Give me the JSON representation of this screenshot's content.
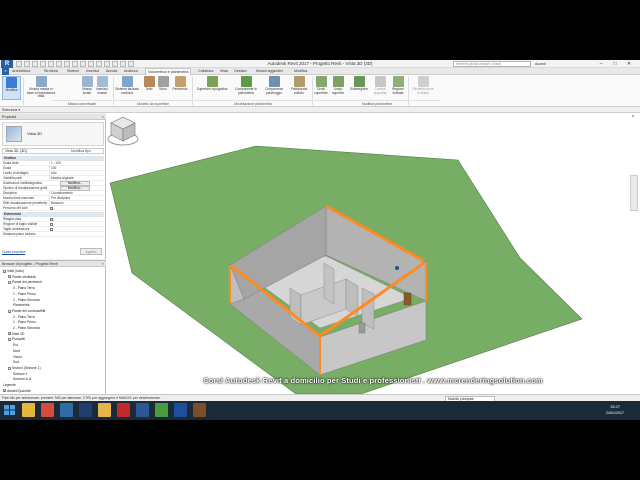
{
  "window": {
    "app_logo": "R",
    "title": "Autodesk Revit 2017 -   Progetto Revit - Vista 3D (3D)",
    "search_placeholder": "Immetti parola chiave o frase",
    "login": "Accedi",
    "min": "–",
    "max": "□",
    "close": "✕"
  },
  "ribbon": {
    "tabs": [
      {
        "label": "Architettura",
        "active": false
      },
      {
        "label": "Struttura",
        "active": false
      },
      {
        "label": "Sistemi",
        "active": false
      },
      {
        "label": "Inserisci",
        "active": false
      },
      {
        "label": "Annota",
        "active": false
      },
      {
        "label": "Analizza",
        "active": false
      },
      {
        "label": "Volumetrico e planimetria",
        "active": true
      },
      {
        "label": "Collabora",
        "active": false
      },
      {
        "label": "Vista",
        "active": false
      },
      {
        "label": "Gestisci",
        "active": false
      },
      {
        "label": "Moduli aggiuntivi",
        "active": false
      },
      {
        "label": "Modifica",
        "active": false
      }
    ],
    "buttons": [
      {
        "label": "Modifica",
        "icon": "cursor-icon",
        "color": "#3a7bd5"
      },
      {
        "label": "Mostra massa in base a impostazioni vista",
        "icon": "mass-icon",
        "color": "#8aa9c9"
      },
      {
        "label": "Massa locale",
        "icon": "local-mass-icon",
        "color": "#9bb4cf"
      },
      {
        "label": "Inserisci massa",
        "icon": "place-mass-icon",
        "color": "#a3bbd3"
      },
      {
        "label": "Sistema facciata continua",
        "icon": "curtain-system-icon",
        "color": "#7ea6cc"
      },
      {
        "label": "Tetto",
        "icon": "roof-icon",
        "color": "#b88a5a"
      },
      {
        "label": "Muro",
        "icon": "wall-icon",
        "color": "#a0a0a0"
      },
      {
        "label": "Pavimento",
        "icon": "floor-icon",
        "color": "#c2a16f"
      },
      {
        "label": "Superficie topografica",
        "icon": "toposurface-icon",
        "color": "#7aa05a"
      },
      {
        "label": "Componente di planimetria",
        "icon": "site-component-icon",
        "color": "#5f9a4a"
      },
      {
        "label": "Componente parcheggio",
        "icon": "parking-icon",
        "color": "#6f8fb0"
      },
      {
        "label": "Piattaforma edificio",
        "icon": "building-pad-icon",
        "color": "#b49b6b"
      },
      {
        "label": "Dividi superficie",
        "icon": "split-surface-icon",
        "color": "#83a86a"
      },
      {
        "label": "Unisci superfici",
        "icon": "merge-surfaces-icon",
        "color": "#7c9f63"
      },
      {
        "label": "Sottoregione",
        "icon": "subregion-icon",
        "color": "#6a9658"
      },
      {
        "label": "Confine proprietà",
        "icon": "property-line-icon",
        "color": "#c7c7c7"
      },
      {
        "label": "Regione livellata",
        "icon": "graded-region-icon",
        "color": "#8fae7a"
      },
      {
        "label": "Etichetta curve di livello",
        "icon": "label-contours-icon",
        "color": "#cfcfcf"
      }
    ],
    "groups": [
      "Seleziona ▾",
      "Massa concettuale",
      "Modello da superficie",
      "Modellazione planimetria",
      "Modifica planimetria"
    ]
  },
  "properties": {
    "header": "Proprietà",
    "type_name": "Vista 3D",
    "instance_value": "Vista 3D: {3D}",
    "edit_type": "Modifica tipo",
    "categories": [
      "Grafica",
      "Estensioni"
    ],
    "rows": [
      {
        "label": "Scala vista",
        "value": "1 : 100"
      },
      {
        "label": "Scala",
        "value": "100"
      },
      {
        "label": "Livello di dettaglio",
        "value": "Alto"
      },
      {
        "label": "Visibilità parti",
        "value": "Mostra originale"
      },
      {
        "label": "Sostituzioni visibilità/grafica",
        "value": "Modifica..."
      },
      {
        "label": "Opzioni di visualizzazione grafica",
        "value": "Modifica..."
      },
      {
        "label": "Disciplina",
        "value": "Coordinamento"
      },
      {
        "label": "Mostra linee nascoste",
        "value": "Per disciplina"
      },
      {
        "label": "Stile visualizzazione predefinito",
        "value": "Nessuno"
      },
      {
        "label": "Percorso del sole",
        "value": ""
      },
      {
        "label": "Ritaglia vista",
        "value": ""
      },
      {
        "label": "Regione di taglio visibile",
        "value": ""
      },
      {
        "label": "Taglio annotazione",
        "value": ""
      },
      {
        "label": "Distanza piano lontano",
        "value": ""
      }
    ],
    "help_link": "Guida proprietà",
    "apply": "Applica"
  },
  "browser": {
    "header": "Browser di progetto - Progetto Revit",
    "items": [
      {
        "label": "Viste (tutto)",
        "level": 0,
        "toggle": "–"
      },
      {
        "label": "Piante strutturali",
        "level": 1,
        "toggle": "+"
      },
      {
        "label": "Piante dei pavimenti",
        "level": 1,
        "toggle": "–"
      },
      {
        "label": "0 - Piano Terra",
        "level": 2,
        "toggle": ""
      },
      {
        "label": "1 - Piano Primo",
        "level": 2,
        "toggle": ""
      },
      {
        "label": "2 - Piano Secondo",
        "level": 2,
        "toggle": ""
      },
      {
        "label": "Planimetria",
        "level": 2,
        "toggle": ""
      },
      {
        "label": "Piante dei controsoffitti",
        "level": 1,
        "toggle": "–"
      },
      {
        "label": "0 - Piano Terra",
        "level": 2,
        "toggle": ""
      },
      {
        "label": "1 - Piano Primo",
        "level": 2,
        "toggle": ""
      },
      {
        "label": "2 - Piano Secondo",
        "level": 2,
        "toggle": ""
      },
      {
        "label": "Viste 3D",
        "level": 1,
        "toggle": "+"
      },
      {
        "label": "Prospetti",
        "level": 1,
        "toggle": "–"
      },
      {
        "label": "Est",
        "level": 2,
        "toggle": ""
      },
      {
        "label": "Nord",
        "level": 2,
        "toggle": ""
      },
      {
        "label": "Ovest",
        "level": 2,
        "toggle": ""
      },
      {
        "label": "Sud",
        "level": 2,
        "toggle": ""
      },
      {
        "label": "Sezioni (Sezione 1)",
        "level": 1,
        "toggle": "–"
      },
      {
        "label": "Sezione 1",
        "level": 2,
        "toggle": ""
      },
      {
        "label": "Sezione A-A'",
        "level": 2,
        "toggle": ""
      },
      {
        "label": "Legende",
        "level": 0,
        "toggle": ""
      },
      {
        "label": "Abachi/Quantità",
        "level": 0,
        "toggle": "+"
      }
    ]
  },
  "viewport": {
    "watermark": "Corsi Autodesk Revit a domicilio per Studi e professionisti . www.mcrenderingsolution.com",
    "terrain_color": "#78ad66",
    "wall_color": "#b7b7b7",
    "highlight_color": "#ff8a1f"
  },
  "statusbar": {
    "text": "Fare clic per selezionare, premere TAB per alternare, CTRL per aggiungere e MAIUSC per deselezionare.",
    "model": "Modello principale"
  },
  "taskbar": {
    "apps": [
      {
        "name": "explorer-icon",
        "color": "#e7b73d"
      },
      {
        "name": "chrome-icon",
        "color": "#d84a3c"
      },
      {
        "name": "media-icon",
        "color": "#2f6ca8"
      },
      {
        "name": "photoshop-icon",
        "color": "#1d3e6e"
      },
      {
        "name": "folder-icon",
        "color": "#e4b64a"
      },
      {
        "name": "acrobat-icon",
        "color": "#c0282a"
      },
      {
        "name": "word-icon",
        "color": "#2b5797"
      },
      {
        "name": "chrome-icon-2",
        "color": "#4a9a3e"
      },
      {
        "name": "revit-icon",
        "color": "#1c4f9c"
      },
      {
        "name": "archive-icon",
        "color": "#7a4f2a"
      }
    ],
    "time": "15:27",
    "date": "24/01/2017"
  }
}
